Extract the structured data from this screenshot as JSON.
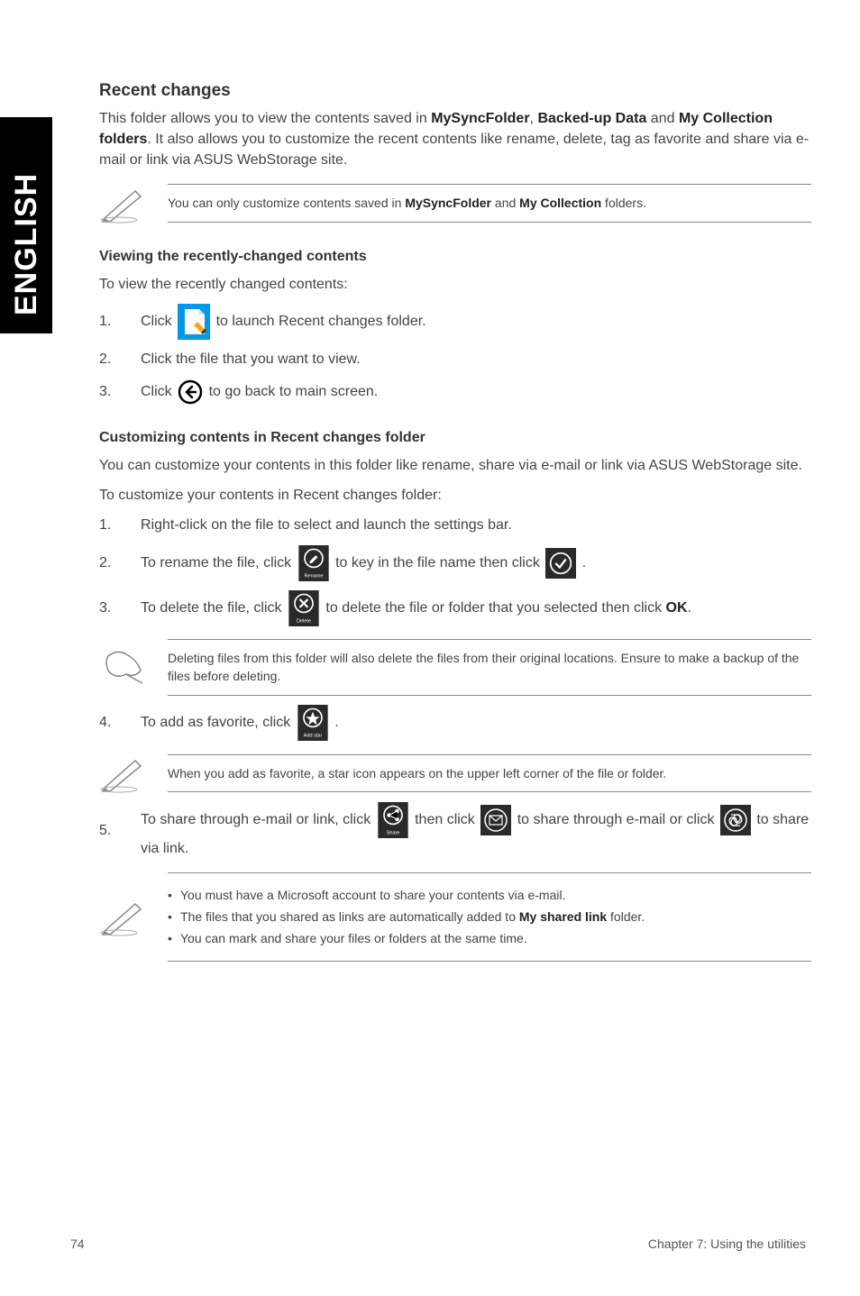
{
  "sideTab": "ENGLISH",
  "section": {
    "title": "Recent changes",
    "intro_prefix": "This folder allows you to view the contents saved in ",
    "intro_b1": "MySyncFolder",
    "intro_sep1": ", ",
    "intro_b2": "Backed-up Data",
    "intro_sep2": " and ",
    "intro_b3": "My Collection folders",
    "intro_suffix": ". It also allows you to customize the recent contents like rename, delete, tag as favorite and share via e-mail or link via ASUS WebStorage site."
  },
  "note1_prefix": "You can only customize contents saved in ",
  "note1_b1": "MySyncFolder",
  "note1_mid": " and ",
  "note1_b2": "My Collection",
  "note1_suffix": " folders.",
  "viewing": {
    "heading": "Viewing the recently-changed contents",
    "lead": "To view the recently changed contents:",
    "s1_a": "Click ",
    "s1_b": " to launch Recent changes folder.",
    "s2": "Click the file that you want to view.",
    "s3_a": "Click ",
    "s3_b": " to go back to main screen."
  },
  "custom": {
    "heading": "Customizing contents in Recent changes folder",
    "lead1": "You can customize your contents in this folder like rename, share via e-mail or link via ASUS WebStorage site.",
    "lead2": "To customize your contents in Recent changes folder:",
    "s1": "Right-click on the file to select and launch the settings bar.",
    "s2_a": "To rename the file, click ",
    "s2_b": " to key in the file name then click ",
    "s2_c": ".",
    "s3_a": "To delete the file, click ",
    "s3_b": " to delete the file or folder that you selected then click ",
    "s3_ok": "OK",
    "s3_c": ".",
    "note2": "Deleting files from this folder will also delete the files from their original locations. Ensure to make a backup of the files before deleting.",
    "s4_a": "To add as favorite, click ",
    "s4_b": ".",
    "note3": "When you add as favorite, a star icon appears on the upper left corner of the file or folder.",
    "s5_a": "To share through e-mail or link, click ",
    "s5_b": " then click ",
    "s5_c": " to share through e-mail or click ",
    "s5_d": " to share via link.",
    "note4_1": "You must have a Microsoft account to share your contents via e-mail.",
    "note4_2a": "The files that you shared as links are automatically added to ",
    "note4_2b": "My shared link",
    "note4_2c": " folder.",
    "note4_3": "You can mark and share your files or folders at the same time."
  },
  "footer": {
    "page": "74",
    "chapter": "Chapter 7: Using the utilities"
  }
}
